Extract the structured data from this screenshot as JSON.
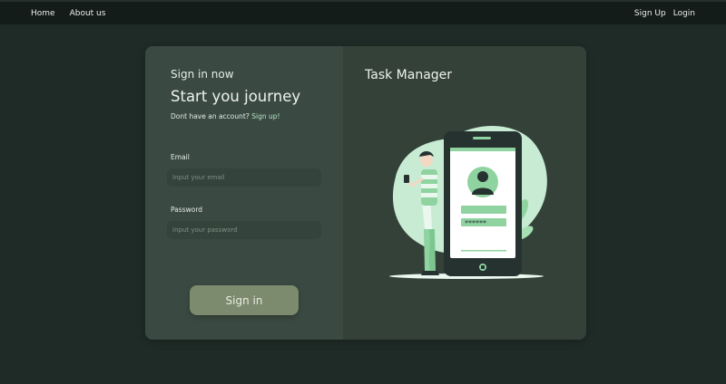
{
  "nav": {
    "home": "Home",
    "about": "About us",
    "signup": "Sign Up",
    "login": "Login"
  },
  "login": {
    "subtitle": "Sign in now",
    "heading": "Start you journey",
    "no_account_text": "Dont have an account?",
    "signup_link": "Sign up!",
    "email_label": "Email",
    "email_placeholder": "Input your email",
    "password_label": "Password",
    "password_placeholder": "Input your password",
    "signin_button": "Sign in"
  },
  "hero": {
    "title": "Task Manager",
    "password_mask": "******",
    "icons": [
      "person-icon",
      "phone-icon",
      "plant-icon",
      "user-avatar-icon"
    ]
  },
  "colors": {
    "background": "#1f2b27",
    "navbar": "#141c19",
    "left_panel": "#3a4a42",
    "right_panel": "#344139",
    "accent_green": "#8fd3a0",
    "button": "#7c8a6d"
  }
}
